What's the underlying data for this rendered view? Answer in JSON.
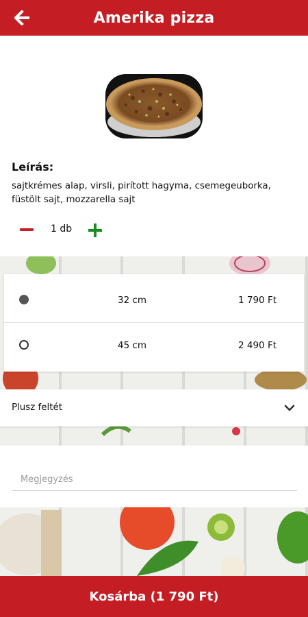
{
  "header": {
    "title": "Amerika pizza",
    "back_icon": "arrow-left-icon"
  },
  "product": {
    "image_alt": "pizza",
    "description_title": "Leírás:",
    "description": "sajtkrémes alap, virsli, pirított hagyma, csemegeuborka, füstölt sajt, mozzarella  sajt"
  },
  "quantity": {
    "label": "1 db",
    "minus_icon": "minus-icon",
    "plus_icon": "plus-icon"
  },
  "sizes": [
    {
      "label": "32 cm",
      "price": "1 790 Ft",
      "selected": true
    },
    {
      "label": "45 cm",
      "price": "2 490 Ft",
      "selected": false
    }
  ],
  "extras": {
    "label": "Plusz feltét",
    "icon": "chevron-down-icon"
  },
  "note": {
    "placeholder": "Megjegyzés",
    "value": ""
  },
  "cart": {
    "label": "Kosárba (1 790 Ft)"
  },
  "colors": {
    "brand_red": "#c41e24",
    "plus_green": "#1a8a23"
  }
}
